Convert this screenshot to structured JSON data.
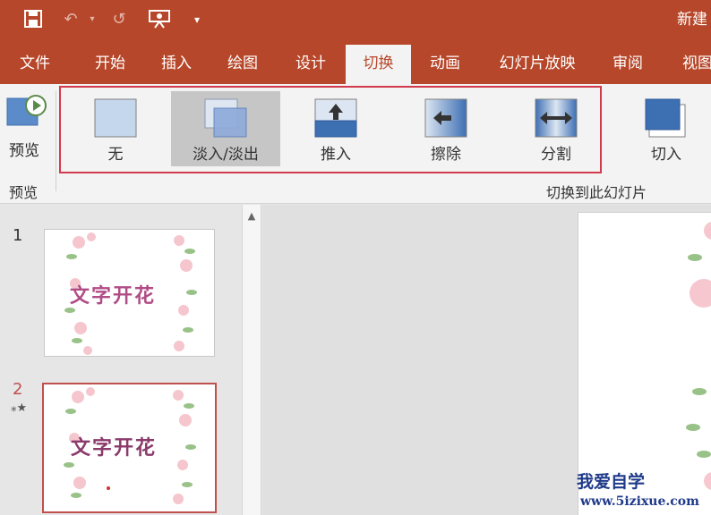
{
  "app": {
    "doc_title": "新建",
    "accent": "#b7472a"
  },
  "qat": {
    "icons": [
      "save-icon",
      "undo-icon",
      "redo-icon",
      "present-icon",
      "customize-dropdown-icon"
    ]
  },
  "tabs": [
    {
      "label": "文件"
    },
    {
      "label": "开始"
    },
    {
      "label": "插入"
    },
    {
      "label": "绘图"
    },
    {
      "label": "设计"
    },
    {
      "label": "切换",
      "active": true
    },
    {
      "label": "动画"
    },
    {
      "label": "幻灯片放映"
    },
    {
      "label": "审阅"
    },
    {
      "label": "视图"
    }
  ],
  "ribbon": {
    "preview_label": "预览",
    "preview_group_label": "预览",
    "transitions_group_label": "切换到此幻灯片",
    "transitions": [
      {
        "label": "无",
        "icon": "none-transition-icon"
      },
      {
        "label": "淡入/淡出",
        "icon": "fade-transition-icon",
        "selected": true
      },
      {
        "label": "推入",
        "icon": "push-transition-icon"
      },
      {
        "label": "擦除",
        "icon": "wipe-transition-icon"
      },
      {
        "label": "分割",
        "icon": "split-transition-icon"
      },
      {
        "label": "切入",
        "icon": "cut-transition-icon"
      }
    ]
  },
  "slides": [
    {
      "number": "1",
      "title": "文字开花",
      "selected": false
    },
    {
      "number": "2",
      "title": "文字开花",
      "selected": true,
      "has_animation": true
    }
  ],
  "watermark": {
    "line1": "我爱自学",
    "line2": "www.5izixue.com"
  }
}
